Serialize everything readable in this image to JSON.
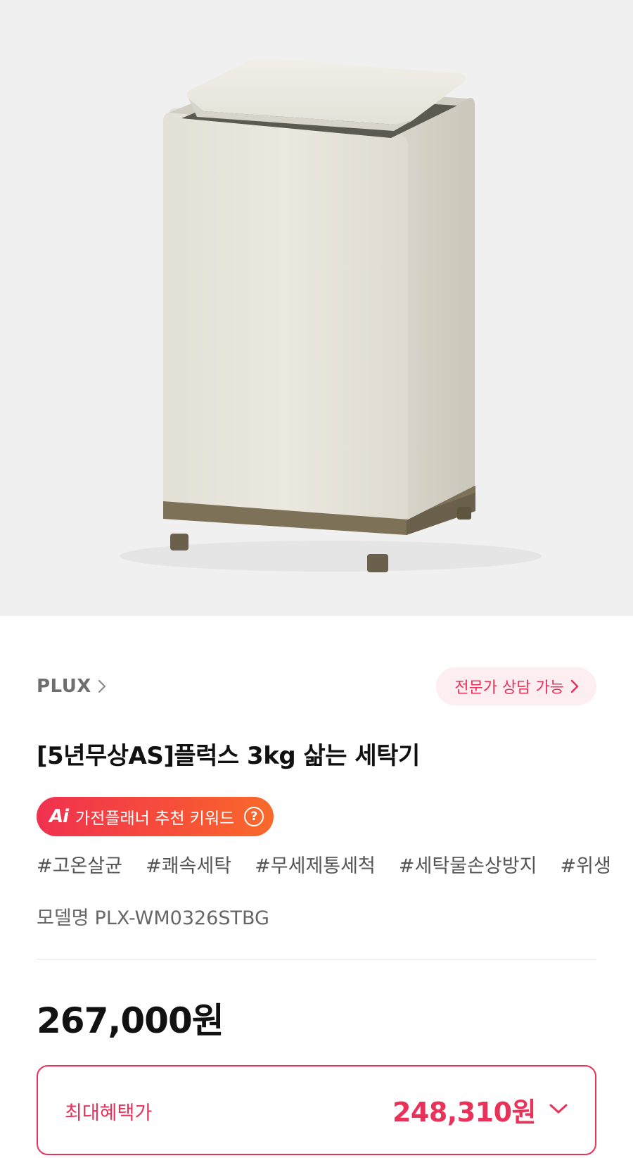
{
  "product": {
    "image_alt": "PLUX 3kg washing machine",
    "brand": "PLUX",
    "consult_label": "전문가 상담 가능",
    "title": "[5년무상AS]플럭스 3kg 삶는 세탁기",
    "ai_chip": {
      "logo": "Ai",
      "label": "가전플래너 추천 키워드",
      "help": "?"
    },
    "tags": [
      "#고온살균",
      "#쾌속세탁",
      "#무세제통세척",
      "#세탁물손상방지",
      "#위생"
    ],
    "model_label": "모델명",
    "model_value": "PLX-WM0326STBG",
    "price": "267,000원",
    "benefit": {
      "label": "최대혜택가",
      "price": "248,310원"
    }
  },
  "colors": {
    "accent": "#e8325a",
    "accent_bg": "#fdeef1",
    "ai_gradient_start": "#f0314f",
    "ai_gradient_end": "#f96a2a",
    "hero_bg": "#f0f0f0",
    "appliance_body": "#e9e6dc",
    "appliance_base": "#7d7158"
  },
  "icons": {
    "brand_chevron": "chevron-right-icon",
    "consult_chevron": "chevron-right-icon",
    "benefit_chevron": "chevron-down-icon",
    "help": "question-circle-icon"
  }
}
